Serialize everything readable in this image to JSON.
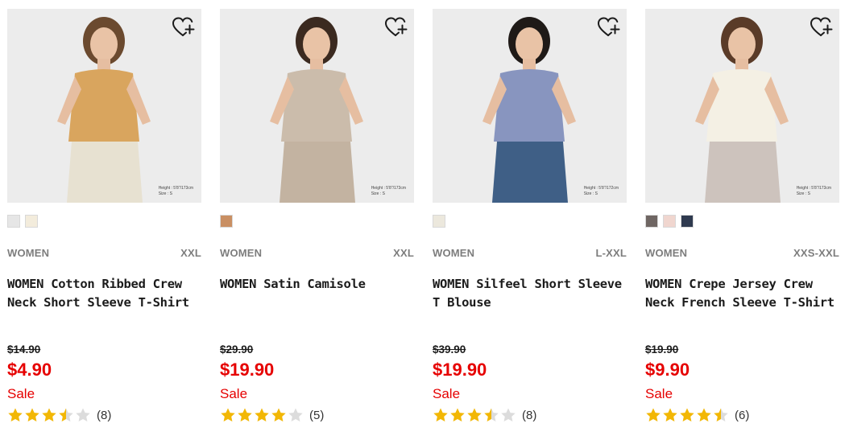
{
  "products": [
    {
      "gender": "WOMEN",
      "sizes": "XXL",
      "title_line1": "WOMEN Cotton Ribbed Crew",
      "title_line2": "Neck Short Sleeve T-Shirt",
      "original_price": "$14.90",
      "price": "$4.90",
      "sale_label": "Sale",
      "rating": 3.5,
      "review_count": "(8)",
      "caption_height": "Height : 5'8\"/173cm",
      "caption_size": "Size : S",
      "swatches": [
        "#e6e6e6",
        "#f3ecdc"
      ],
      "photo_bg": "#ececec",
      "top_color": "#d9a55e",
      "bottom_color": "#e7e1d1",
      "hair_color": "#6b4a2f",
      "favorite_icon": "heart-plus-icon"
    },
    {
      "gender": "WOMEN",
      "sizes": "XXL",
      "title_line1": "WOMEN Satin Camisole",
      "title_line2": "",
      "original_price": "$29.90",
      "price": "$19.90",
      "sale_label": "Sale",
      "rating": 4,
      "review_count": "(5)",
      "caption_height": "Height : 5'8\"/173cm",
      "caption_size": "Size : S",
      "swatches": [
        "#c98f63"
      ],
      "photo_bg": "#ececec",
      "top_color": "#cbbcab",
      "bottom_color": "#c3b3a1",
      "hair_color": "#3b2a20",
      "favorite_icon": "heart-plus-icon"
    },
    {
      "gender": "WOMEN",
      "sizes": "L-XXL",
      "title_line1": "WOMEN Silfeel Short Sleeve",
      "title_line2": "T Blouse",
      "original_price": "$39.90",
      "price": "$19.90",
      "sale_label": "Sale",
      "rating": 3.5,
      "review_count": "(8)",
      "caption_height": "Height : 5'8\"/172cm",
      "caption_size": "Size : S",
      "swatches": [
        "#ece8dd"
      ],
      "photo_bg": "#ececec",
      "top_color": "#8895bf",
      "bottom_color": "#3f5f86",
      "hair_color": "#1f1a17",
      "favorite_icon": "heart-plus-icon"
    },
    {
      "gender": "WOMEN",
      "sizes": "XXS-XXL",
      "title_line1": "WOMEN Crepe Jersey Crew",
      "title_line2": "Neck French Sleeve T-Shirt",
      "original_price": "$19.90",
      "price": "$9.90",
      "sale_label": "Sale",
      "rating": 4.5,
      "review_count": "(6)",
      "caption_height": "Height : 5'8\"/173cm",
      "caption_size": "Size : S",
      "swatches": [
        "#6f6663",
        "#f0d6cf",
        "#2f3a4f"
      ],
      "photo_bg": "#ececec",
      "top_color": "#f4f0e4",
      "bottom_color": "#cdc3bd",
      "hair_color": "#5a3b28",
      "favorite_icon": "heart-plus-icon"
    }
  ],
  "colors": {
    "sale_red": "#e60000",
    "star_gold": "#f2b705",
    "star_empty": "#dcdcdc",
    "meta_grey": "#7d7d7d"
  }
}
